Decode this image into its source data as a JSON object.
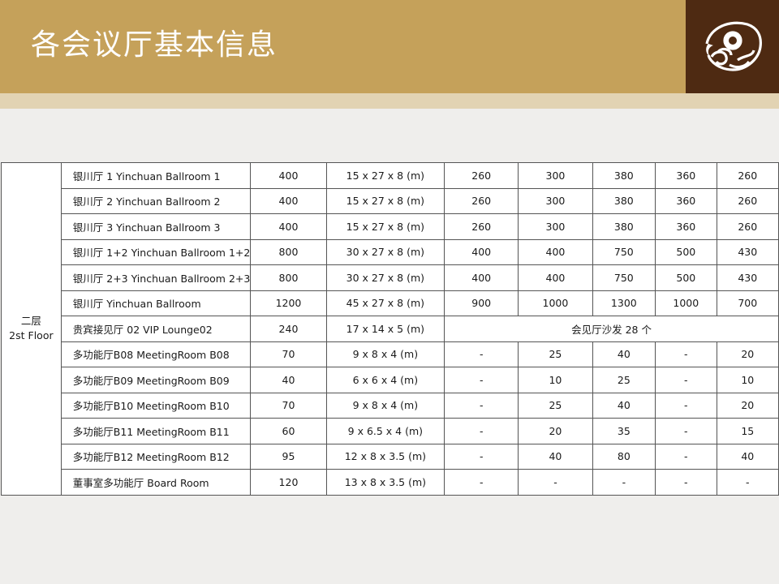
{
  "header": {
    "title": "各会议厅基本信息"
  },
  "colors": {
    "header_gold": "#c5a15a",
    "header_light": "#e2d3b3",
    "logo_bg": "#4e2a12",
    "background": "#efeeec"
  },
  "logo": {
    "icon": "cloud-ring-logo"
  },
  "table": {
    "floor_label": [
      "二层",
      "2st Floor"
    ],
    "rows": [
      {
        "name": "银川厅 1  Yinchuan Ballroom 1",
        "area": "400",
        "dims": "15 x 27 x 8 (m)",
        "c1": "260",
        "c2": "300",
        "c3": "380",
        "c4": "360",
        "c5": "260"
      },
      {
        "name": "银川厅 2  Yinchuan Ballroom 2",
        "area": "400",
        "dims": "15 x 27 x 8 (m)",
        "c1": "260",
        "c2": "300",
        "c3": "380",
        "c4": "360",
        "c5": "260"
      },
      {
        "name": "银川厅 3  Yinchuan Ballroom 3",
        "area": "400",
        "dims": "15 x 27 x 8 (m)",
        "c1": "260",
        "c2": "300",
        "c3": "380",
        "c4": "360",
        "c5": "260"
      },
      {
        "name": "银川厅 1+2  Yinchuan Ballroom 1+2",
        "area": "800",
        "dims": "30 x 27 x 8 (m)",
        "c1": "400",
        "c2": "400",
        "c3": "750",
        "c4": "500",
        "c5": "430"
      },
      {
        "name": "银川厅 2+3  Yinchuan Ballroom 2+3",
        "area": "800",
        "dims": "30 x 27 x 8 (m)",
        "c1": "400",
        "c2": "400",
        "c3": "750",
        "c4": "500",
        "c5": "430"
      },
      {
        "name": "银川厅    Yinchuan Ballroom",
        "area": "1200",
        "dims": "45 x 27 x 8 (m)",
        "c1": "900",
        "c2": "1000",
        "c3": "1300",
        "c4": "1000",
        "c5": "700"
      },
      {
        "name": "贵宾接见厅 02  VIP Lounge02",
        "area": "240",
        "dims": "17 x 14 x 5 (m)",
        "merged": "会见厅沙发 28 个"
      },
      {
        "name": "多功能厅B08  MeetingRoom  B08",
        "area": "70",
        "dims": "9 x 8 x 4 (m)",
        "c1": "-",
        "c2": "25",
        "c3": "40",
        "c4": "-",
        "c5": "20"
      },
      {
        "name": "多功能厅B09  MeetingRoom  B09",
        "area": "40",
        "dims": "6 x 6 x 4 (m)",
        "c1": "-",
        "c2": "10",
        "c3": "25",
        "c4": "-",
        "c5": "10"
      },
      {
        "name": "多功能厅B10  MeetingRoom  B10",
        "area": "70",
        "dims": "9 x 8 x 4 (m)",
        "c1": "-",
        "c2": "25",
        "c3": "40",
        "c4": "-",
        "c5": "20"
      },
      {
        "name": "多功能厅B11  MeetingRoom  B11",
        "area": "60",
        "dims": "9 x 6.5 x 4 (m)",
        "c1": "-",
        "c2": "20",
        "c3": "35",
        "c4": "-",
        "c5": "15"
      },
      {
        "name": "多功能厅B12  MeetingRoom  B12",
        "area": "95",
        "dims": "12 x 8 x 3.5 (m)",
        "c1": "-",
        "c2": "40",
        "c3": "80",
        "c4": "-",
        "c5": "40"
      },
      {
        "name": "董事室多功能厅    Board Room",
        "area": "120",
        "dims": "13 x 8 x 3.5 (m)",
        "c1": "-",
        "c2": "-",
        "c3": "-",
        "c4": "-",
        "c5": "-"
      }
    ]
  }
}
